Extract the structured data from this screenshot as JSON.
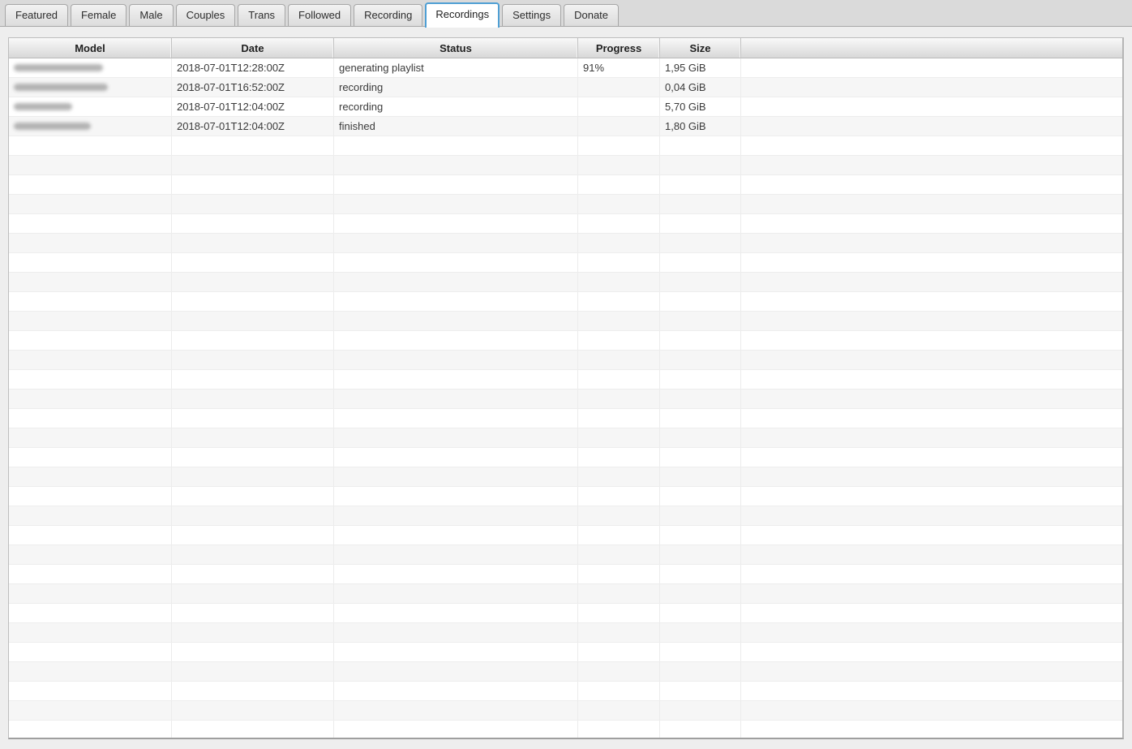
{
  "accent_color": "#4f9fd4",
  "tabs": [
    {
      "label": "Featured",
      "active": false
    },
    {
      "label": "Female",
      "active": false
    },
    {
      "label": "Male",
      "active": false
    },
    {
      "label": "Couples",
      "active": false
    },
    {
      "label": "Trans",
      "active": false
    },
    {
      "label": "Followed",
      "active": false
    },
    {
      "label": "Recording",
      "active": false
    },
    {
      "label": "Recordings",
      "active": true
    },
    {
      "label": "Settings",
      "active": false
    },
    {
      "label": "Donate",
      "active": false
    }
  ],
  "table": {
    "columns": [
      {
        "label": "Model"
      },
      {
        "label": "Date"
      },
      {
        "label": "Status"
      },
      {
        "label": "Progress"
      },
      {
        "label": "Size"
      },
      {
        "label": ""
      }
    ],
    "rows": [
      {
        "model_redacted": true,
        "model_redacted_width": 110,
        "date": "2018-07-01T12:28:00Z",
        "status": "generating playlist",
        "progress": "91%",
        "size": "1,95 GiB"
      },
      {
        "model_redacted": true,
        "model_redacted_width": 116,
        "date": "2018-07-01T16:52:00Z",
        "status": "recording",
        "progress": "",
        "size": "0,04 GiB"
      },
      {
        "model_redacted": true,
        "model_redacted_width": 72,
        "date": "2018-07-01T12:04:00Z",
        "status": "recording",
        "progress": "",
        "size": "5,70 GiB"
      },
      {
        "model_redacted": true,
        "model_redacted_width": 95,
        "date": "2018-07-01T12:04:00Z",
        "status": "finished",
        "progress": "",
        "size": "1,80 GiB"
      }
    ],
    "empty_row_count": 31
  }
}
